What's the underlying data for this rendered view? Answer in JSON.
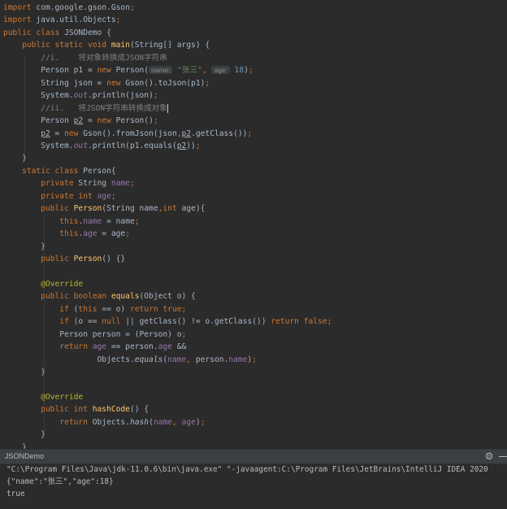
{
  "editor": {
    "lines": [
      [
        {
          "t": "import",
          "c": "k"
        },
        {
          "t": " com.google.gson.Gson",
          "c": ""
        },
        {
          "t": ";",
          "c": "k"
        }
      ],
      [
        {
          "t": "import",
          "c": "k"
        },
        {
          "t": " java.util.Objects",
          "c": ""
        },
        {
          "t": ";",
          "c": "k"
        }
      ],
      [
        {
          "t": "public class ",
          "c": "k"
        },
        {
          "t": "JSONDemo {",
          "c": ""
        }
      ],
      [
        {
          "t": "    public static void ",
          "c": "k"
        },
        {
          "t": "main",
          "c": "m"
        },
        {
          "t": "(String[] args) {",
          "c": ""
        }
      ],
      [
        {
          "t": "        //i.    将对象转换成JSON字符串",
          "c": "c"
        }
      ],
      [
        {
          "t": "        Person p1 = ",
          "c": ""
        },
        {
          "t": "new ",
          "c": "k"
        },
        {
          "t": "Person(",
          "c": ""
        },
        {
          "t": "name:",
          "c": "hint"
        },
        {
          "t": " ",
          "c": ""
        },
        {
          "t": "\"张三\"",
          "c": "s"
        },
        {
          "t": ", ",
          "c": "k"
        },
        {
          "t": "age:",
          "c": "hint"
        },
        {
          "t": " ",
          "c": ""
        },
        {
          "t": "18",
          "c": "n"
        },
        {
          "t": ")",
          "c": ""
        },
        {
          "t": ";",
          "c": "k"
        }
      ],
      [
        {
          "t": "        String json = ",
          "c": ""
        },
        {
          "t": "new ",
          "c": "k"
        },
        {
          "t": "Gson().toJson(p1)",
          "c": ""
        },
        {
          "t": ";",
          "c": "k"
        }
      ],
      [
        {
          "t": "        System.",
          "c": ""
        },
        {
          "t": "out",
          "c": "fi"
        },
        {
          "t": ".println(json)",
          "c": ""
        },
        {
          "t": ";",
          "c": "k"
        }
      ],
      [
        {
          "t": "        //ii.   将JSON字符串转换成对象",
          "c": "c"
        },
        {
          "t": "",
          "c": "cur"
        }
      ],
      [
        {
          "t": "        Person ",
          "c": ""
        },
        {
          "t": "p2",
          "c": "u"
        },
        {
          "t": " = ",
          "c": ""
        },
        {
          "t": "new ",
          "c": "k"
        },
        {
          "t": "Person()",
          "c": ""
        },
        {
          "t": ";",
          "c": "k"
        }
      ],
      [
        {
          "t": "        ",
          "c": ""
        },
        {
          "t": "p2",
          "c": "u"
        },
        {
          "t": " = ",
          "c": ""
        },
        {
          "t": "new ",
          "c": "k"
        },
        {
          "t": "Gson().fromJson(json",
          "c": ""
        },
        {
          "t": ",",
          "c": "k"
        },
        {
          "t": "p2",
          "c": "u"
        },
        {
          "t": ".getClass())",
          "c": ""
        },
        {
          "t": ";",
          "c": "k"
        }
      ],
      [
        {
          "t": "        System.",
          "c": ""
        },
        {
          "t": "out",
          "c": "fi"
        },
        {
          "t": ".println(p1.equals(",
          "c": ""
        },
        {
          "t": "p2",
          "c": "u"
        },
        {
          "t": "))",
          "c": ""
        },
        {
          "t": ";",
          "c": "k"
        }
      ],
      [
        {
          "t": "    }",
          "c": ""
        }
      ],
      [
        {
          "t": "    static class ",
          "c": "k"
        },
        {
          "t": "Person{",
          "c": ""
        }
      ],
      [
        {
          "t": "        private ",
          "c": "k"
        },
        {
          "t": "String ",
          "c": ""
        },
        {
          "t": "name",
          "c": "f"
        },
        {
          "t": ";",
          "c": "k"
        }
      ],
      [
        {
          "t": "        private int ",
          "c": "k"
        },
        {
          "t": "age",
          "c": "f"
        },
        {
          "t": ";",
          "c": "k"
        }
      ],
      [
        {
          "t": "        public ",
          "c": "k"
        },
        {
          "t": "Person",
          "c": "m"
        },
        {
          "t": "(String name",
          "c": ""
        },
        {
          "t": ",",
          "c": "k"
        },
        {
          "t": "int ",
          "c": "k"
        },
        {
          "t": "age){",
          "c": ""
        }
      ],
      [
        {
          "t": "            this",
          "c": "k"
        },
        {
          "t": ".",
          "c": ""
        },
        {
          "t": "name",
          "c": "f"
        },
        {
          "t": " = name",
          "c": ""
        },
        {
          "t": ";",
          "c": "k"
        }
      ],
      [
        {
          "t": "            this",
          "c": "k"
        },
        {
          "t": ".",
          "c": ""
        },
        {
          "t": "age",
          "c": "f"
        },
        {
          "t": " = age",
          "c": ""
        },
        {
          "t": ";",
          "c": "k"
        }
      ],
      [
        {
          "t": "        }",
          "c": ""
        }
      ],
      [
        {
          "t": "        public ",
          "c": "k"
        },
        {
          "t": "Person",
          "c": "m"
        },
        {
          "t": "() {}",
          "c": ""
        }
      ],
      [
        {
          "t": "",
          "c": ""
        }
      ],
      [
        {
          "t": "        @Override",
          "c": "a"
        }
      ],
      [
        {
          "t": "        public boolean ",
          "c": "k"
        },
        {
          "t": "equals",
          "c": "m"
        },
        {
          "t": "(Object o) {",
          "c": ""
        }
      ],
      [
        {
          "t": "            if ",
          "c": "k"
        },
        {
          "t": "(",
          "c": ""
        },
        {
          "t": "this ",
          "c": "k"
        },
        {
          "t": "== o) ",
          "c": ""
        },
        {
          "t": "return true",
          "c": "k"
        },
        {
          "t": ";",
          "c": "k"
        }
      ],
      [
        {
          "t": "            if ",
          "c": "k"
        },
        {
          "t": "(o == ",
          "c": ""
        },
        {
          "t": "null ",
          "c": "k"
        },
        {
          "t": "|| getClass() != o.getClass()) ",
          "c": ""
        },
        {
          "t": "return false",
          "c": "k"
        },
        {
          "t": ";",
          "c": "k"
        }
      ],
      [
        {
          "t": "            Person person = (Person) o",
          "c": ""
        },
        {
          "t": ";",
          "c": "k"
        }
      ],
      [
        {
          "t": "            return ",
          "c": "k"
        },
        {
          "t": "age",
          "c": "f"
        },
        {
          "t": " == person.",
          "c": ""
        },
        {
          "t": "age",
          "c": "f"
        },
        {
          "t": " &&",
          "c": ""
        }
      ],
      [
        {
          "t": "                    Objects.",
          "c": ""
        },
        {
          "t": "equals",
          "c": "it"
        },
        {
          "t": "(",
          "c": ""
        },
        {
          "t": "name",
          "c": "f"
        },
        {
          "t": ", ",
          "c": "k"
        },
        {
          "t": "person.",
          "c": ""
        },
        {
          "t": "name",
          "c": "f"
        },
        {
          "t": ")",
          "c": ""
        },
        {
          "t": ";",
          "c": "k"
        }
      ],
      [
        {
          "t": "        }",
          "c": ""
        }
      ],
      [
        {
          "t": "",
          "c": ""
        }
      ],
      [
        {
          "t": "        @Override",
          "c": "a"
        }
      ],
      [
        {
          "t": "        public int ",
          "c": "k"
        },
        {
          "t": "hashCode",
          "c": "m"
        },
        {
          "t": "() {",
          "c": ""
        }
      ],
      [
        {
          "t": "            return ",
          "c": "k"
        },
        {
          "t": "Objects.",
          "c": ""
        },
        {
          "t": "hash",
          "c": "it"
        },
        {
          "t": "(",
          "c": ""
        },
        {
          "t": "name",
          "c": "f"
        },
        {
          "t": ", ",
          "c": "k"
        },
        {
          "t": "age",
          "c": "f"
        },
        {
          "t": ")",
          "c": ""
        },
        {
          "t": ";",
          "c": "k"
        }
      ],
      [
        {
          "t": "        }",
          "c": ""
        }
      ],
      [
        {
          "t": "    }",
          "c": ""
        }
      ]
    ]
  },
  "run": {
    "tab_label": "JSONDemo",
    "gear_icon": "gear-icon",
    "output": [
      "\"C:\\Program Files\\Java\\jdk-11.0.6\\bin\\java.exe\" \"-javaagent:C:\\Program Files\\JetBrains\\IntelliJ IDEA 2020",
      "{\"name\":\"张三\",\"age\":18}",
      "true"
    ]
  }
}
